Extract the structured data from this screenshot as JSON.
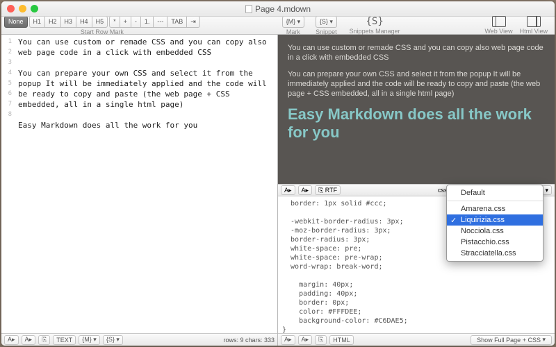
{
  "window": {
    "title": "Page 4.mdown"
  },
  "toolbar": {
    "none": "None",
    "headings": [
      "H1",
      "H2",
      "H3",
      "H4",
      "H5"
    ],
    "symbols": [
      "*",
      "+",
      "-",
      "1.",
      "---",
      "TAB",
      "⇥"
    ],
    "start_row_mark": "Start Row Mark",
    "m_btn": "{M} ▾",
    "s_btn": "{S} ▾",
    "mark": "Mark",
    "snippet": "Snippet",
    "snippets_mgr": "Snippets Manager",
    "web_view": "Web View",
    "html_view": "Html View"
  },
  "editor": {
    "line_numbers": [
      "1",
      "2",
      "3",
      "4",
      "5",
      "6",
      "7",
      "8"
    ],
    "text": "You can use custom or remade CSS and you can copy also web page code in a click with embedded CSS\n\nYou can prepare your own CSS and select it from the popup It will be immediately applied and the code will be ready to copy and paste (the web page + CSS embedded, all in a single html page)\n\nEasy Markdown does all the work for you"
  },
  "status_left": {
    "a_big": "A▸",
    "a_small": "A▸",
    "pin": "⎘",
    "text_btn": "TEXT",
    "m": "{M} ▾",
    "s": "{S} ▾",
    "info": "rows: 9 chars: 333"
  },
  "preview": {
    "p1": "You can use custom or remade CSS and you can copy also web page code in a click with embedded CSS",
    "p2": "You can prepare your own CSS and select it from the popup It will be immediately applied and the code will be ready to copy and paste (the web page + CSS embedded, all in a single html page)",
    "h2": "Easy Markdown does all the work for you"
  },
  "css_bar": {
    "a_big": "A▸",
    "a_small": "A▸",
    "rtf": "⎘ RTF",
    "css_label": "css:"
  },
  "css_code": "  border: 1px solid #ccc;\n\n  -webkit-border-radius: 3px;\n  -moz-border-radius: 3px;\n  border-radius: 3px;\n  white-space: pre;\n  white-space: pre-wrap;\n  word-wrap: break-word;\n\n    margin: 40px;\n    padding: 40px;\n    border: 0px;\n    color: #FFFDEE;\n    background-color: #C6DAE5;\n}",
  "status_right": {
    "a_big": "A▸",
    "a_small": "A▸",
    "pin": "⎘",
    "html_btn": "HTML",
    "show": "Show Full Page + CSS"
  },
  "dropdown": {
    "items": [
      "Default",
      "Amarena.css",
      "Liquirizia.css",
      "Nocciola.css",
      "Pistacchio.css",
      "Stracciatella.css"
    ],
    "selected_index": 2
  }
}
